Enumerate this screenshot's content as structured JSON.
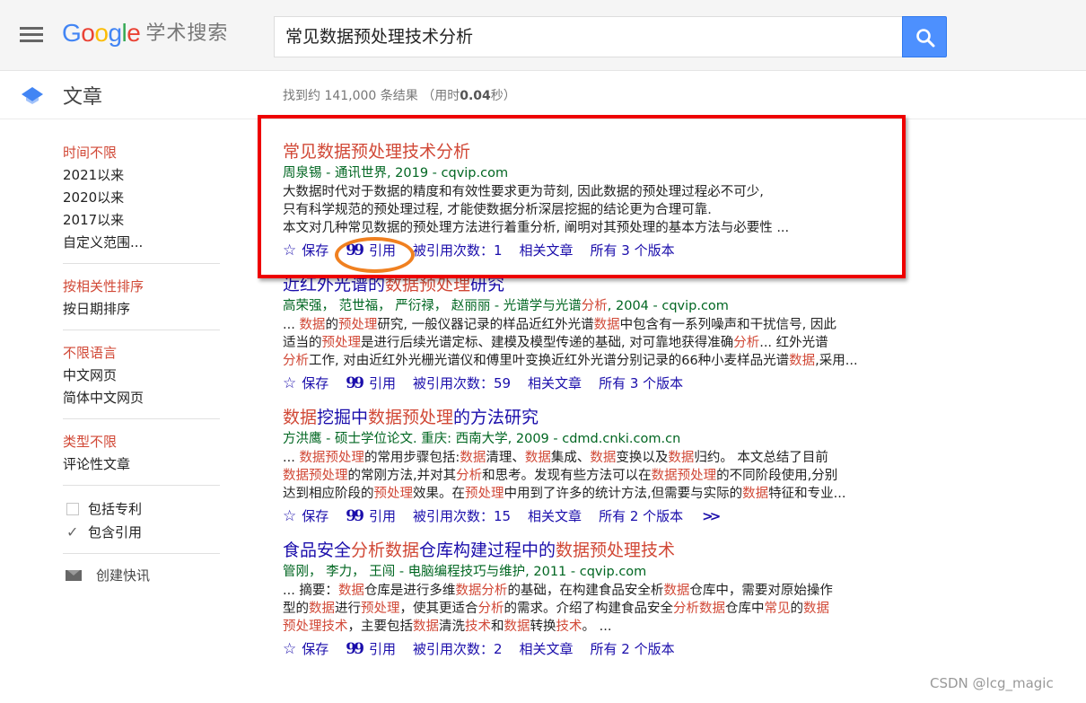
{
  "header": {
    "logo_text": "Google",
    "logo_suffix": "学术搜索",
    "logo_colors": [
      "#4285f4",
      "#ea4335",
      "#fbbc05",
      "#4285f4",
      "#34a853",
      "#ea4335"
    ],
    "search_value": "常见数据预处理技术分析"
  },
  "subheader": {
    "section_label": "文章",
    "stats_prefix": "找到约 141,000 条结果 （用时",
    "stats_time": "0.04",
    "stats_suffix": "秒）"
  },
  "sidebar": {
    "time": [
      "时间不限",
      "2021以来",
      "2020以来",
      "2017以来",
      "自定义范围..."
    ],
    "sort": [
      "按相关性排序",
      "按日期排序"
    ],
    "lang": [
      "不限语言",
      "中文网页",
      "简体中文网页"
    ],
    "type": [
      "类型不限",
      "评论性文章"
    ],
    "checks": [
      {
        "label": "包括专利",
        "checked": false
      },
      {
        "label": "包含引用",
        "checked": true
      }
    ],
    "alert_label": "创建快讯"
  },
  "results": [
    {
      "title": "常见数据预处理技术分析",
      "meta": "周泉锡 - 通讯世界, 2019 - cqvip.com",
      "snippet": [
        "大数据时代对于数据的精度和有效性要求更为苛刻, 因此数据的预处理过程必不可少,",
        "只有科学规范的预处理过程, 才能使数据分析深层挖掘的结论更为合理可靠.",
        "本文对几种常见数据的预处理方法进行着重分析, 阐明对其预处理的基本方法与必要性 ..."
      ],
      "save": "保存",
      "cite": "引用",
      "cited_by": "被引用次数：1",
      "related": "相关文章",
      "versions": "所有 3 个版本"
    },
    {
      "title_a": "近红外光谱的",
      "title_b": "数据预处理",
      "title_c": "研究",
      "meta": "高荣强， 范世福， 严衍禄， 赵丽丽 - 光谱学与光谱",
      "meta_hl": "分析",
      "meta_tail": ", 2004 - cqvip.com",
      "s1": [
        "... ",
        "数据",
        "的",
        "预处理",
        "研究, 一般仪器记录的样品近红外光谱",
        "数据",
        "中包含有一系列噪声和干扰信号, 因此"
      ],
      "s2": [
        "适当的",
        "预处理",
        "是进行后续光谱定标、建模及模型传递的基础, 对可靠地获得准确",
        "分析",
        "... 红外光谱"
      ],
      "s3": [
        "分析",
        "工作, 对由近红外光栅光谱仪和傅里叶变换近红外光谱分别记录的66种小麦样品光谱",
        "数据",
        ",采用..."
      ],
      "save": "保存",
      "cite": "引用",
      "cited_by": "被引用次数：59",
      "related": "相关文章",
      "versions": "所有 3 个版本"
    },
    {
      "title_a": "数据",
      "title_b": "挖掘中",
      "title_c": "数据预处理",
      "title_d": "的方法研究",
      "meta": "方洪鹰 - 硕士学位论文. 重庆: 西南大学, 2009 - cdmd.cnki.com.cn",
      "s1": [
        "... ",
        "数据预处理",
        "的常用步骤包括:",
        "数据",
        "清理、",
        "数据",
        "集成、",
        "数据",
        "变换以及",
        "数据",
        "归约。 本文总结了目前"
      ],
      "s2": [
        "数据预处理",
        "的常刚方法,并对其",
        "分析",
        "和思考。发现有些方法可以在",
        "数据预处理",
        "的不同阶段使用,分别"
      ],
      "s3": [
        "达到相应阶段的",
        "预处理",
        "效果。在",
        "预处理",
        "中用到了许多的统计方法,但需要与实际的",
        "数据",
        "特征和专业..."
      ],
      "save": "保存",
      "cite": "引用",
      "cited_by": "被引用次数：15",
      "related": "相关文章",
      "versions": "所有 2 个版本"
    },
    {
      "title_a": "食品安全",
      "title_b": "分析数据",
      "title_c": "仓库构建过程中的",
      "title_d": "数据预处理技术",
      "meta": "管刚， 李力， 王闯 - 电脑编程技巧与维护, 2011 - cqvip.com",
      "s1": [
        "... 摘要：",
        "数据",
        "仓库是进行多维",
        "数据分析",
        "的基础，在构建食品安全析",
        "数据",
        "仓库中，需要对原始操作"
      ],
      "s2": [
        "型的",
        "数据",
        "进行",
        "预处理",
        "，使其更适合",
        "分析",
        "的需求。介绍了构建食品安全",
        "分析数据",
        "仓库中",
        "常见",
        "的",
        "数据"
      ],
      "s3": [
        "预处理技术",
        "，主要包括",
        "数据",
        "清洗",
        "技术",
        "和",
        "数据",
        "转换",
        "技术",
        "。 ..."
      ],
      "save": "保存",
      "cite": "引用",
      "cited_by": "被引用次数：2",
      "related": "相关文章",
      "versions": "所有 2 个版本"
    }
  ],
  "watermark": "CSDN @lcg_magic",
  "colors": {
    "link": "#1a0dab",
    "highlight": "#d14836",
    "meta": "#006621",
    "annotation_box": "#e00000",
    "annotation_ring": "#f08020"
  }
}
